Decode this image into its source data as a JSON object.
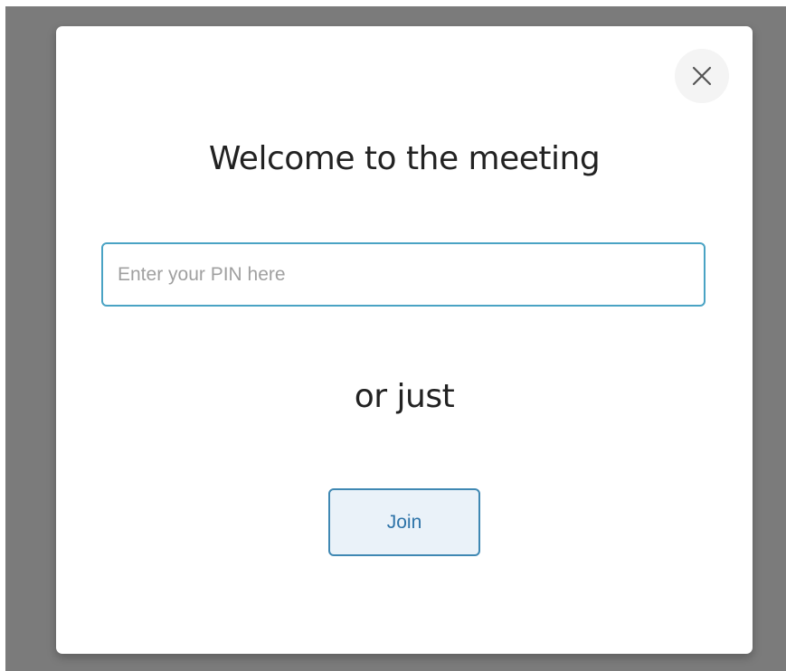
{
  "modal": {
    "title": "Welcome to the meeting",
    "pin_input": {
      "value": "",
      "placeholder": "Enter your PIN here"
    },
    "separator_text": "or just",
    "join_label": "Join",
    "close_icon": "close-icon"
  },
  "colors": {
    "overlay": "#7b7b7b",
    "input_border": "#4aa3c4",
    "button_border": "#3f88b3",
    "button_bg": "#eaf2f9",
    "button_text": "#2d73a8"
  }
}
